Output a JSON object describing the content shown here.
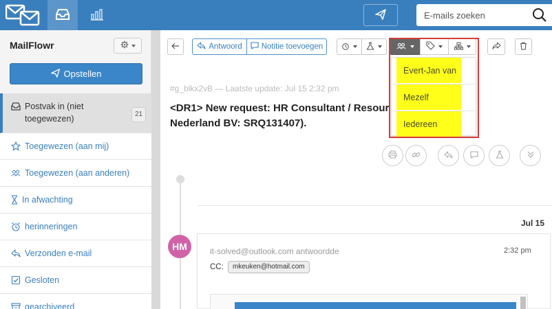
{
  "app": {
    "name": "MailFlowr"
  },
  "topbar": {
    "search_placeholder": "E-mails zoeken"
  },
  "sidebar": {
    "title": "MailFlowr",
    "compose_label": "Opstellen",
    "folders": [
      {
        "label": "Postvak in (niet toegewezen)",
        "count": "21",
        "icon": "inbox-icon"
      },
      {
        "label": "Toegewezen (aan mij)",
        "icon": "star-icon"
      },
      {
        "label": "Toegewezen (aan anderen)",
        "icon": "users-icon"
      },
      {
        "label": "In afwachting",
        "icon": "hourglass-icon"
      },
      {
        "label": "herinneringen",
        "icon": "alarm-icon"
      },
      {
        "label": "Verzonden e-mail",
        "icon": "reply-icon"
      },
      {
        "label": "Gesloten",
        "icon": "check-square-icon"
      },
      {
        "label": "gearchiveerd",
        "icon": "archive-icon"
      }
    ]
  },
  "toolbar": {
    "reply_label": "Antwoord",
    "note_label": "Notitie toevoegen"
  },
  "email": {
    "meta": "#g_blkx2vB — Laatste update: Jul 15 2:32 pm",
    "subject_line1": "<DR1> New request: HR Consultant / Resour",
    "subject_line2": "Nederland BV: SRQ131407).",
    "date_divider": "Jul 15",
    "message": {
      "avatar_initials": "HM",
      "sender": "it-solved@outlook.com antwoordde",
      "time": "2:32 pm",
      "cc_label": "CC:",
      "cc_value": "mkeuken@hotmail.com"
    }
  },
  "assign_dropdown": {
    "options": [
      "Evert-Jan van",
      "Mezelf",
      "Iedereen"
    ],
    "highlight_color": "#ffff1a"
  },
  "colors": {
    "primary": "#3a7fbd",
    "avatar": "#d063a8",
    "annotation": "#d53b3b"
  }
}
